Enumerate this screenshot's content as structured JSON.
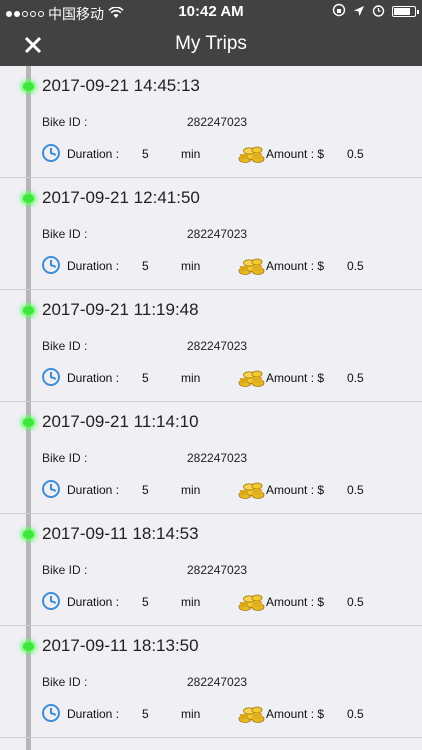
{
  "status_bar": {
    "carrier": "中国移动",
    "time": "10:42 AM"
  },
  "nav": {
    "title": "My Trips",
    "close_icon": "close-icon"
  },
  "labels": {
    "bike_id": "Bike ID :",
    "duration": "Duration :",
    "duration_unit": "min",
    "amount": "Amount : $"
  },
  "trips": [
    {
      "datetime": "2017-09-21 14:45:13",
      "bike_id": "282247023",
      "duration": "5",
      "amount": "0.5"
    },
    {
      "datetime": "2017-09-21 12:41:50",
      "bike_id": "282247023",
      "duration": "5",
      "amount": "0.5"
    },
    {
      "datetime": "2017-09-21 11:19:48",
      "bike_id": "282247023",
      "duration": "5",
      "amount": "0.5"
    },
    {
      "datetime": "2017-09-21 11:14:10",
      "bike_id": "282247023",
      "duration": "5",
      "amount": "0.5"
    },
    {
      "datetime": "2017-09-11 18:14:53",
      "bike_id": "282247023",
      "duration": "5",
      "amount": "0.5"
    },
    {
      "datetime": "2017-09-11 18:13:50",
      "bike_id": "282247023",
      "duration": "5",
      "amount": "0.5"
    }
  ]
}
